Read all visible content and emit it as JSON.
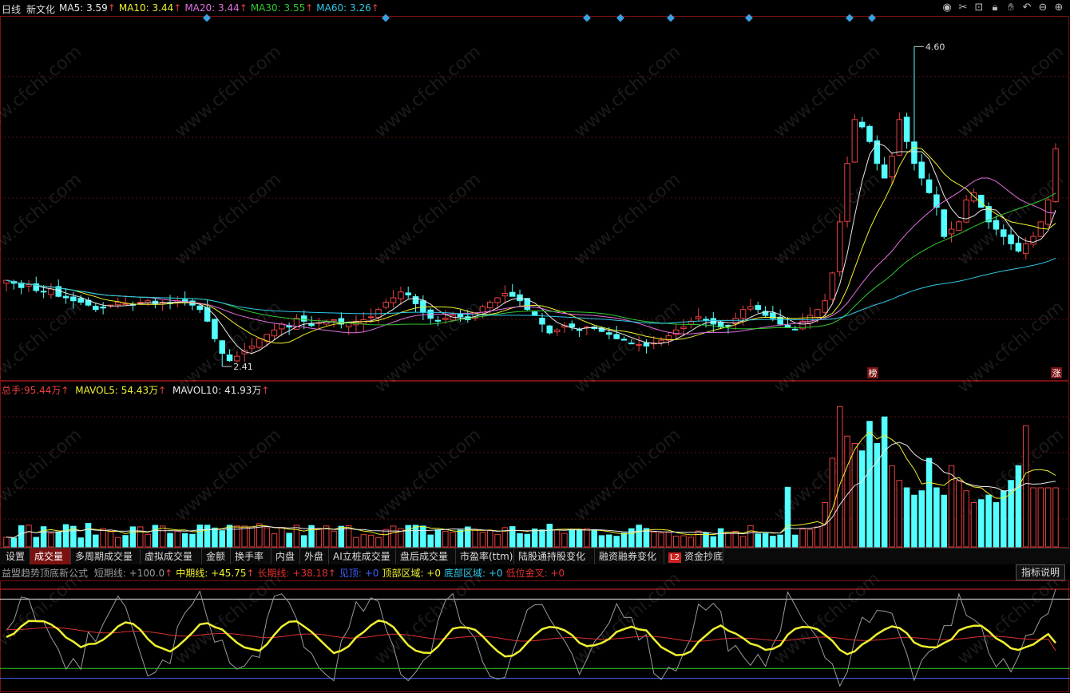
{
  "header": {
    "period": "日线",
    "stock_name": "新文化",
    "ma": [
      {
        "label": "MA5:",
        "value": "3.59",
        "color": "#e8e8e8"
      },
      {
        "label": "MA10:",
        "value": "3.44",
        "color": "#f0f030"
      },
      {
        "label": "MA20:",
        "value": "3.44",
        "color": "#e070e0"
      },
      {
        "label": "MA30:",
        "value": "3.55",
        "color": "#30c830"
      },
      {
        "label": "MA60:",
        "value": "3.26",
        "color": "#30c8e8"
      }
    ],
    "arrow": "↑",
    "toolbar_icons": [
      "eye-icon",
      "cross-cursor-icon",
      "restore-icon",
      "lock-icon",
      "hand-icon",
      "undo-icon",
      "zoom-out-icon",
      "zoom-in-icon"
    ]
  },
  "price_chart": {
    "high_label": "4.60",
    "low_label": "2.41",
    "badge_bang": "榜",
    "badge_zhang": "涨"
  },
  "volume_header": {
    "total_label": "总手:",
    "total_value": "95.44万",
    "mavol5_label": "MAVOL5:",
    "mavol5_value": "54.43万",
    "mavol10_label": "MAVOL10:",
    "mavol10_value": "41.93万",
    "arrow": "↑"
  },
  "tabs": [
    "设置",
    "成交量",
    "多周期成交量",
    "虚拟成交量",
    "金额",
    "换手率",
    "内盘",
    "外盘",
    "AI立桩成交量",
    "盘后成交量",
    "市盈率(ttm)",
    "陆股通持股变化",
    "融资融券变化",
    "资金抄底"
  ],
  "tabs_active": "成交量",
  "tab_l2_badge": "L2",
  "indicator": {
    "name": "益盟趋势顶底新公式",
    "items": [
      {
        "label": "短期线:",
        "value": "+100.0",
        "arrow": "↑",
        "color": "#9a9a9a"
      },
      {
        "label": "中期线:",
        "value": "+45.75",
        "arrow": "↑",
        "color": "#f0f030"
      },
      {
        "label": "长期线:",
        "value": "+38.18",
        "arrow": "↑",
        "color": "#e03030"
      },
      {
        "label": "见顶:",
        "value": "+0",
        "arrow": "",
        "color": "#4060ff"
      },
      {
        "label": "顶部区域:",
        "value": "+0",
        "arrow": "",
        "color": "#f0f030"
      },
      {
        "label": "底部区域:",
        "value": "+0",
        "arrow": "",
        "color": "#30c8e8"
      },
      {
        "label": "低位金叉:",
        "value": "+0",
        "arrow": "",
        "color": "#e03030"
      }
    ],
    "help_button": "指标说明"
  },
  "watermark": "www.cfchi.com",
  "colors": {
    "up": "#e84040",
    "down": "#54ffff",
    "grid": "#5a1010",
    "signal": "#3aa0e0"
  }
}
